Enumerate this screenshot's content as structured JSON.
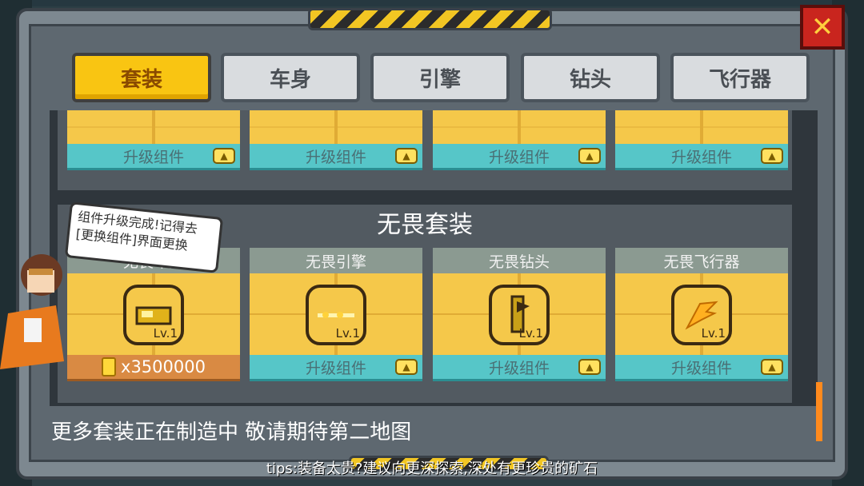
{
  "tabs": [
    {
      "label": "套装",
      "active": true
    },
    {
      "label": "车身",
      "active": false
    },
    {
      "label": "引擎",
      "active": false
    },
    {
      "label": "钻头",
      "active": false
    },
    {
      "label": "飞行器",
      "active": false
    }
  ],
  "close_label": "✕",
  "upper_row": {
    "buttons": [
      "升级组件",
      "升级组件",
      "升级组件",
      "升级组件"
    ]
  },
  "set": {
    "title": "无畏套装",
    "cards": [
      {
        "title": "无畏车身",
        "level": "Lv.1",
        "price": "x3500000",
        "icon": "car-body-icon"
      },
      {
        "title": "无畏引擎",
        "level": "Lv.1",
        "button": "升级组件",
        "icon": "engine-icon"
      },
      {
        "title": "无畏钻头",
        "level": "Lv.1",
        "button": "升级组件",
        "icon": "drill-icon"
      },
      {
        "title": "无畏飞行器",
        "level": "Lv.1",
        "button": "升级组件",
        "icon": "wings-icon"
      }
    ]
  },
  "speech_bubble": "组件升级完成!记得去[更换组件]界面更换",
  "footer_text": "更多套装正在制造中   敬请期待第二地图",
  "tips": "tips:装备太贵?建议向更深探索,深处有更珍贵的矿石",
  "colors": {
    "accent": "#f9c512",
    "button": "#56c6c8",
    "price": "#d98a43",
    "close": "#c9251e"
  }
}
